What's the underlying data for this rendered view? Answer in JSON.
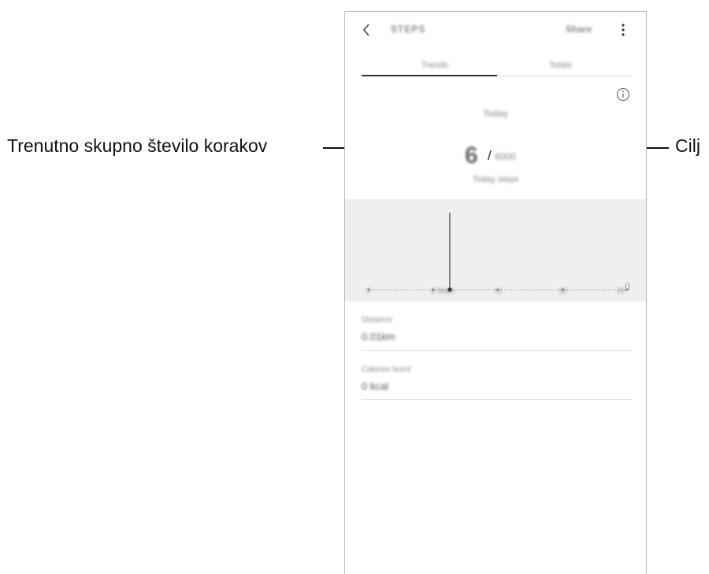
{
  "callouts": {
    "left_label": "Trenutno skupno število korakov",
    "right_label": "Cilj"
  },
  "header": {
    "title": "STEPS",
    "share_label": "Share"
  },
  "tabs": [
    {
      "label": "Trends",
      "active": true
    },
    {
      "label": "Totals",
      "active": false
    }
  ],
  "summary": {
    "day_label": "Today",
    "current_steps": "6",
    "separator": "/",
    "goal_steps": "6000",
    "subtitle": "Today steps"
  },
  "chart_data": {
    "type": "line",
    "title": "",
    "tick_labels": [
      "0",
      "6 Steps",
      "12",
      "18",
      "24"
    ],
    "extra_label": "()",
    "highlight": {
      "tick_index": 1,
      "value": 6
    },
    "grid": false
  },
  "stats": [
    {
      "label": "Distance",
      "value": "0.01km"
    },
    {
      "label": "Calories burnt",
      "value": "0 kcal"
    }
  ],
  "colors": {
    "accent": "#333333",
    "chart_background": "#efefef",
    "divider": "#d2d2d2"
  },
  "icons": {
    "back": "chevron-left-icon",
    "more": "more-vertical-icon",
    "info": "info-icon"
  }
}
